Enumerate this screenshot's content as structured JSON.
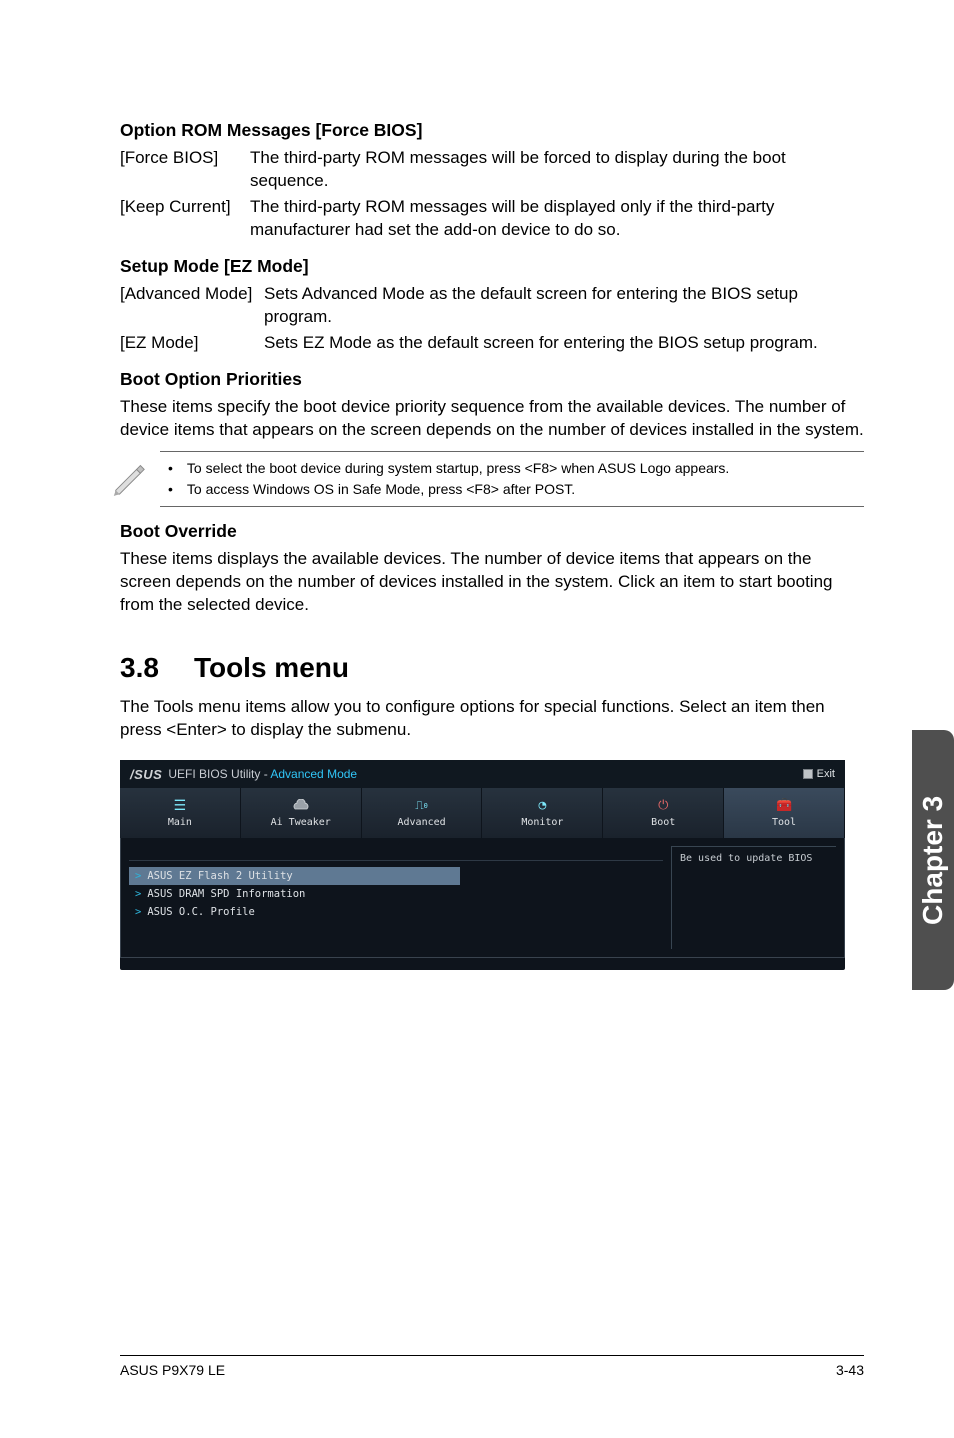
{
  "option_rom": {
    "heading": "Option ROM Messages [Force BIOS]",
    "rows": [
      {
        "term": "[Force BIOS]",
        "def": "The third-party ROM messages will be forced to display during the boot sequence."
      },
      {
        "term": "[Keep Current]",
        "def": "The third-party ROM messages will be displayed only if the third-party manufacturer had set the add-on device to do so."
      }
    ]
  },
  "setup_mode": {
    "heading": "Setup Mode [EZ Mode]",
    "rows": [
      {
        "term": "[Advanced Mode]",
        "def": "Sets Advanced Mode as the default screen for entering the BIOS setup program."
      },
      {
        "term": "[EZ Mode]",
        "def": "Sets EZ Mode as the default screen for entering the BIOS setup program."
      }
    ]
  },
  "boot_priority": {
    "heading": "Boot Option Priorities",
    "para": "These items specify the boot device priority sequence from the available devices. The number of device items that appears on the screen depends on the number of devices installed in the system.",
    "notes": [
      "To select the boot device during system startup, press <F8> when ASUS Logo appears.",
      "To access Windows OS in Safe Mode, press <F8> after POST."
    ]
  },
  "boot_override": {
    "heading": "Boot Override",
    "para": "These items displays the available devices. The number of device items that appears on the screen depends on the number of devices installed in the system. Click an item to start booting from the selected device."
  },
  "tools_section": {
    "num": "3.8",
    "title": "Tools menu",
    "para": "The Tools menu items allow you to configure options for special functions. Select an item then press <Enter> to display the submenu."
  },
  "bios": {
    "header": {
      "brand": "/SUS",
      "title1": "UEFI BIOS Utility - ",
      "title2": "Advanced Mode",
      "exit": "Exit"
    },
    "tabs": [
      {
        "label": "Main"
      },
      {
        "label": "Ai Tweaker"
      },
      {
        "label": "Advanced"
      },
      {
        "label": "Monitor"
      },
      {
        "label": "Boot"
      },
      {
        "label": "Tool"
      }
    ],
    "rows": [
      "ASUS EZ Flash 2 Utility",
      "ASUS DRAM SPD Information",
      "ASUS O.C. Profile"
    ],
    "help": "Be used to update BIOS"
  },
  "side_tab": "Chapter 3",
  "footer": {
    "left": "ASUS P9X79 LE",
    "right": "3-43"
  }
}
